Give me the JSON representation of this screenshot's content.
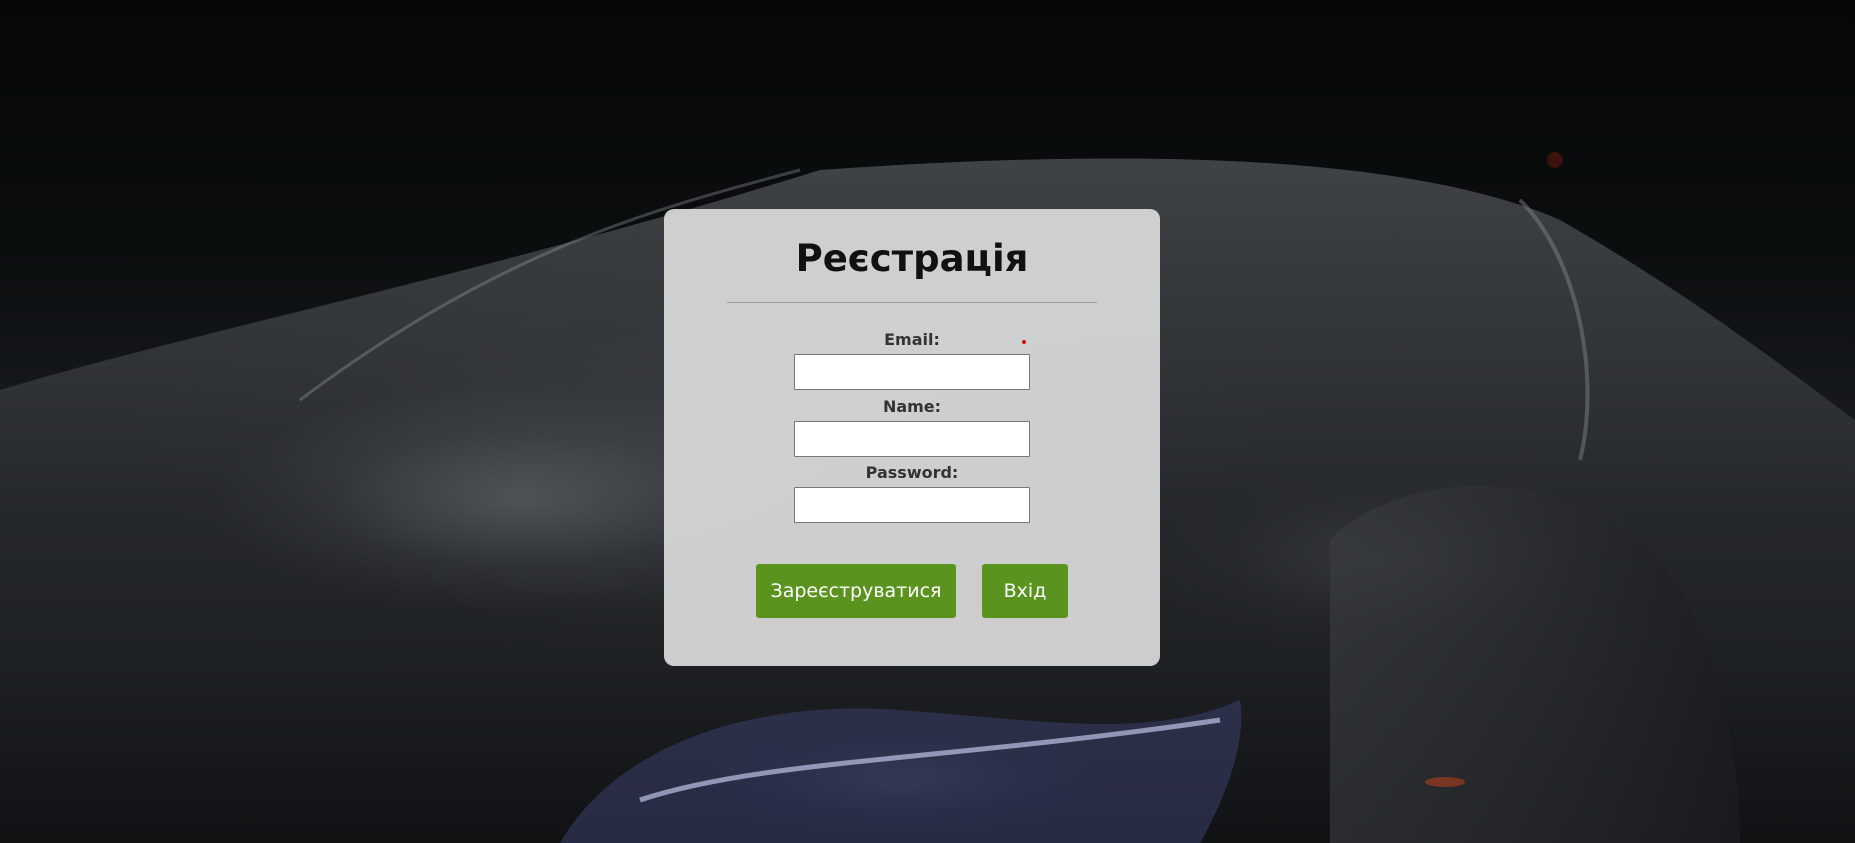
{
  "form": {
    "title": "Реєстрація",
    "fields": [
      {
        "label": "Email:",
        "value": "",
        "placeholder": ""
      },
      {
        "label": "Name:",
        "value": "",
        "placeholder": ""
      },
      {
        "label": "Password:",
        "value": "",
        "placeholder": ""
      }
    ],
    "buttons": {
      "register_label": "Зареєструватися",
      "login_label": "Вхід"
    }
  },
  "colors": {
    "button_bg": "#5a941e",
    "button_text": "#ffffff",
    "panel_bg": "#dadada",
    "required_marker": "#d01010"
  }
}
